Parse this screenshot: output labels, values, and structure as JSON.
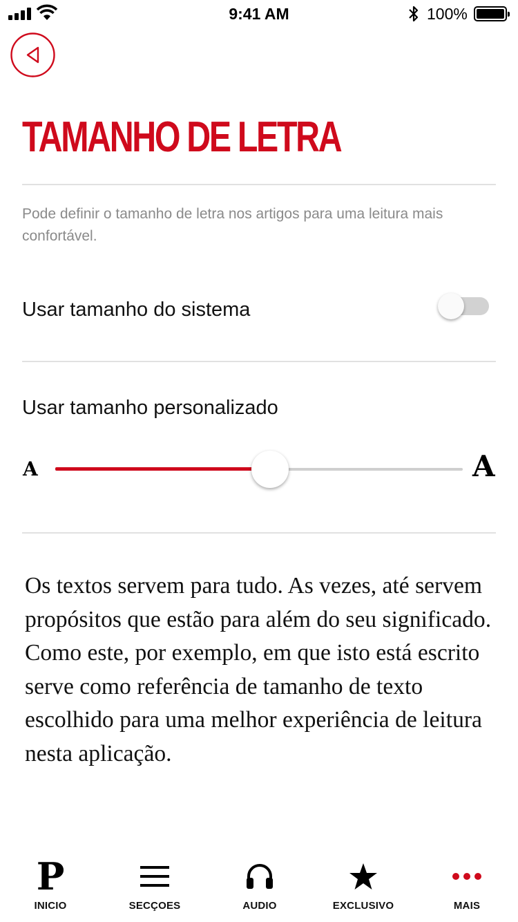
{
  "status_bar": {
    "time": "9:41 AM",
    "battery": "100%"
  },
  "header": {
    "back_icon": "back-arrow-circle-icon",
    "title": "TAMANHO DE LETRA"
  },
  "description": "Pode definir o tamanho de letra nos artigos para uma leitura mais confortável.",
  "system_size": {
    "label": "Usar tamanho do sistema",
    "enabled": false
  },
  "custom_size": {
    "label": "Usar tamanho personalizado",
    "small_glyph": "A",
    "large_glyph": "A",
    "level": 0.5
  },
  "sample_text": "Os textos servem para tudo. As vezes, até servem propósitos que estão para além do seu significado. Como este, por exemplo, em que isto está escrito serve como referência de tamanho de texto escolhido para uma melhor experiência de leitura nesta aplicação.",
  "tab_bar": {
    "items": [
      {
        "label": "INICIO",
        "icon": "publico-p-icon",
        "glyph": "P"
      },
      {
        "label": "SECÇOES",
        "icon": "hamburger-menu-icon"
      },
      {
        "label": "AUDIO",
        "icon": "headphones-icon"
      },
      {
        "label": "EXCLUSIVO",
        "icon": "star-icon"
      },
      {
        "label": "MAIS",
        "icon": "more-dots-icon"
      }
    ]
  },
  "colors": {
    "accent": "#cf0a1c",
    "divider": "#e1e1e1",
    "muted_text": "#8a8a8a"
  }
}
